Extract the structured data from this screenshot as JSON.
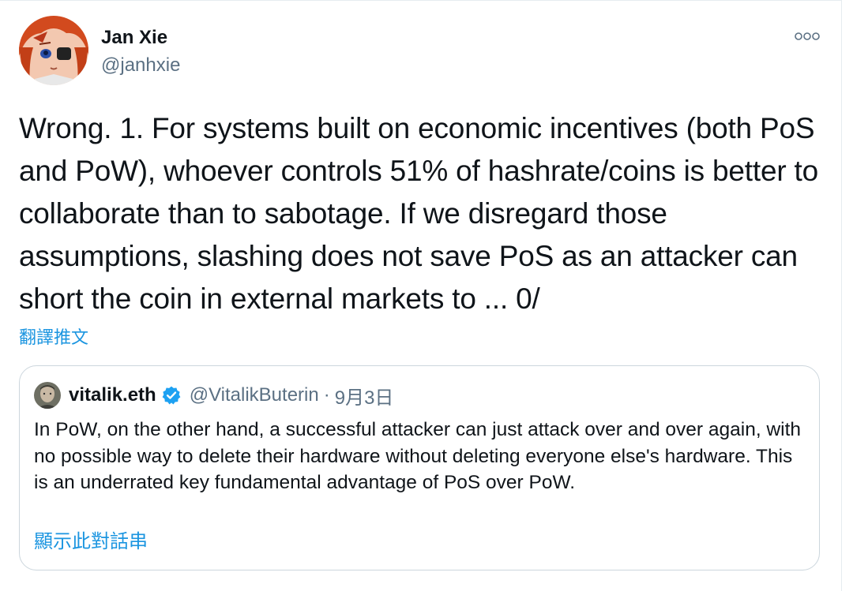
{
  "tweet": {
    "author_name": "Jan Xie",
    "author_handle": "@janhxie",
    "more_icon": "more-horizontal-icon",
    "text": "Wrong. 1. For systems built on economic incentives (both PoS and PoW), whoever controls 51% of hashrate/coins is better to collaborate than to sabotage. If we disregard those assumptions, slashing does not save PoS as an attacker can short the coin in external markets to ... 0/",
    "translate_label": "翻譯推文"
  },
  "quoted_tweet": {
    "author_name": "vitalik.eth",
    "verified_icon": "verified-badge-icon",
    "author_handle": "@VitalikButerin",
    "date": "9月3日",
    "text": "In PoW, on the other hand, a successful attacker can just attack over and over again, with no possible way to delete their hardware without deleting everyone else's hardware. This is an underrated key fundamental advantage of PoS over PoW.",
    "show_thread_label": "顯示此對話串"
  },
  "colors": {
    "link_blue": "#1b95e0",
    "verified_blue": "#1da1f2",
    "secondary_text": "#5b7083",
    "border": "#ccd6dd"
  }
}
